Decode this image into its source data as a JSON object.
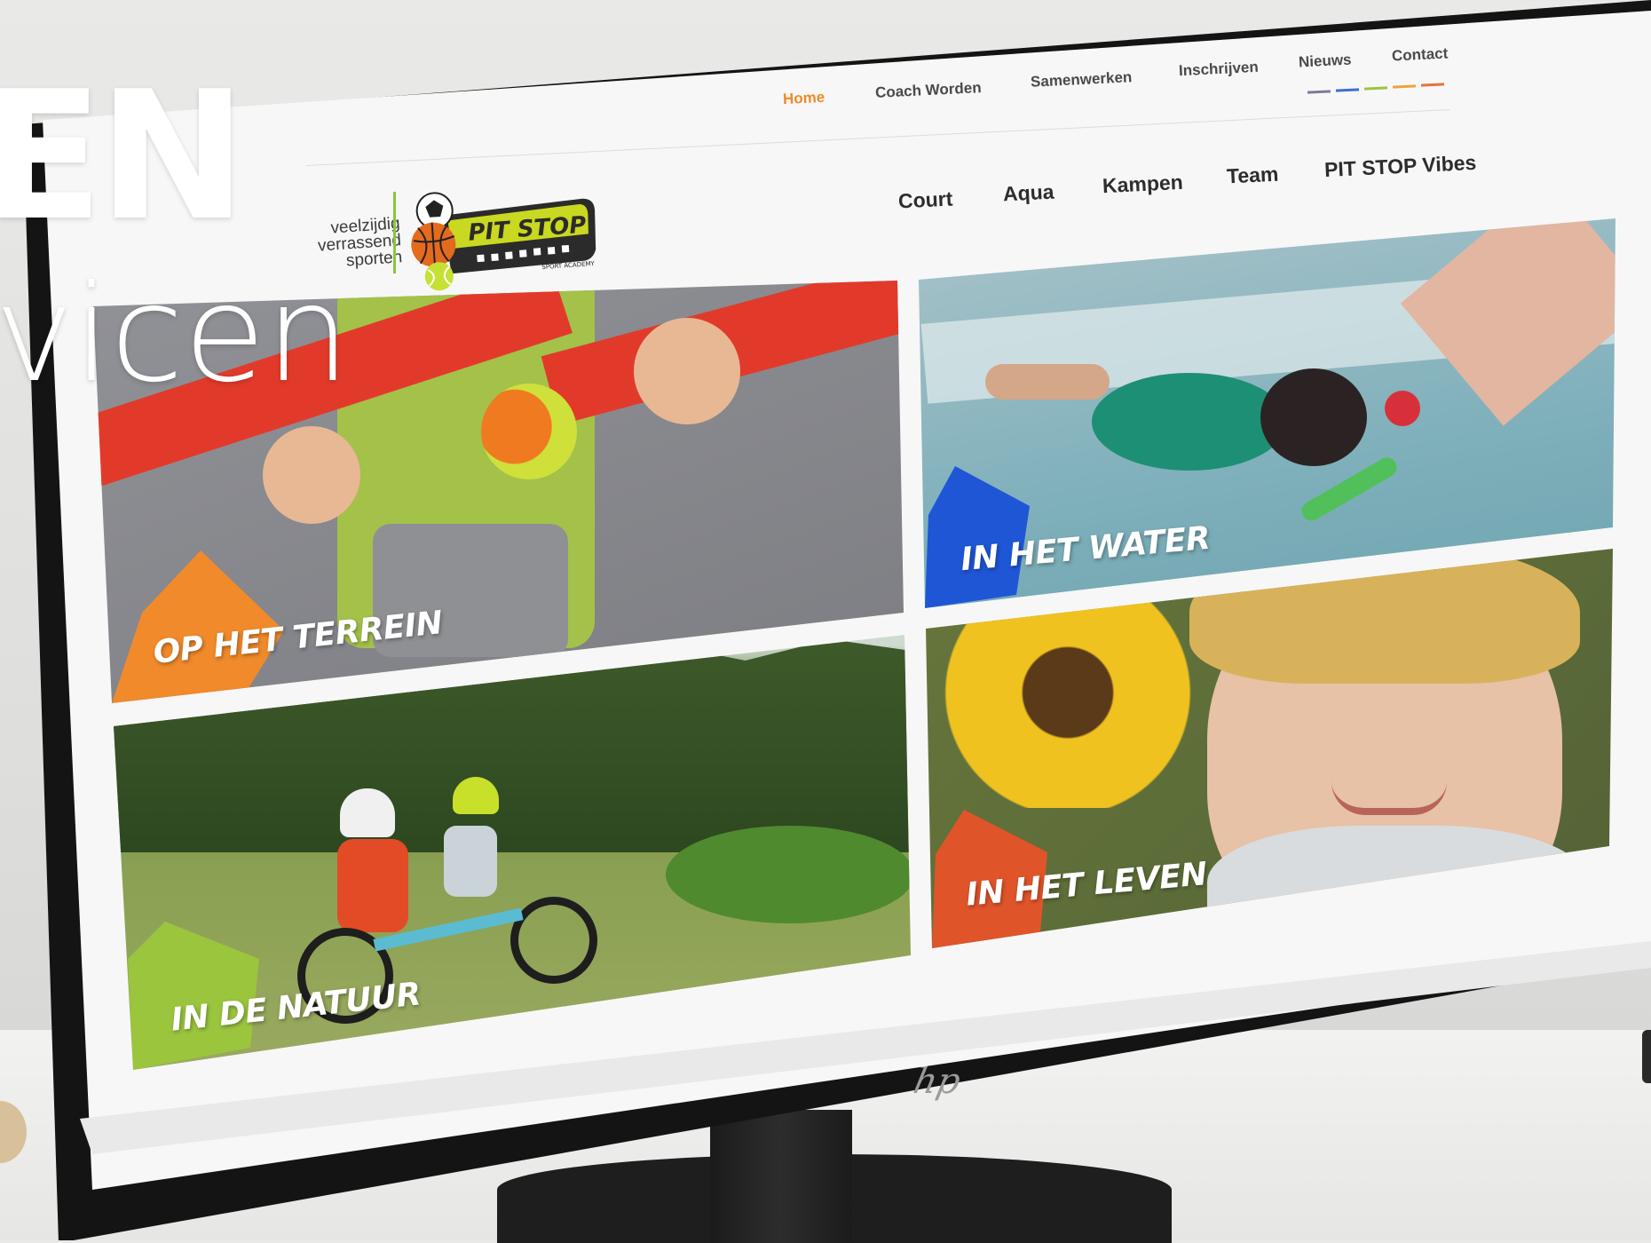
{
  "overlay": {
    "big_text": "EN",
    "small_text": "vicen"
  },
  "top_nav": {
    "items": [
      {
        "label": "Home",
        "active": true
      },
      {
        "label": "Coach Worden"
      },
      {
        "label": "Samenwerken"
      },
      {
        "label": "Inschrijven"
      },
      {
        "label": "Nieuws"
      },
      {
        "label": "Contact"
      }
    ],
    "underline_colors": [
      "#7a7a9a",
      "#3b6fd4",
      "#9bc53d",
      "#f0a040",
      "#e8703a"
    ]
  },
  "main_nav": {
    "items": [
      {
        "label": "Court"
      },
      {
        "label": "Aqua"
      },
      {
        "label": "Kampen"
      },
      {
        "label": "Team"
      },
      {
        "label": "PIT STOP Vibes"
      }
    ]
  },
  "logo": {
    "tagline_1": "veelzijdig",
    "tagline_2": "verrassend",
    "tagline_3": "sporten",
    "brand": "PIT STOP",
    "sub": "SPORT ACADEMY"
  },
  "tiles": [
    {
      "label": "OP HET TERREIN",
      "accent": "#f08a2b"
    },
    {
      "label": "IN HET WATER",
      "accent": "#1f56d6"
    },
    {
      "label": "IN DE NATUUR",
      "accent": "#9bc53d"
    },
    {
      "label": "IN HET LEVEN",
      "accent": "#e0542a"
    }
  ],
  "monitor": {
    "brand": "hp"
  }
}
